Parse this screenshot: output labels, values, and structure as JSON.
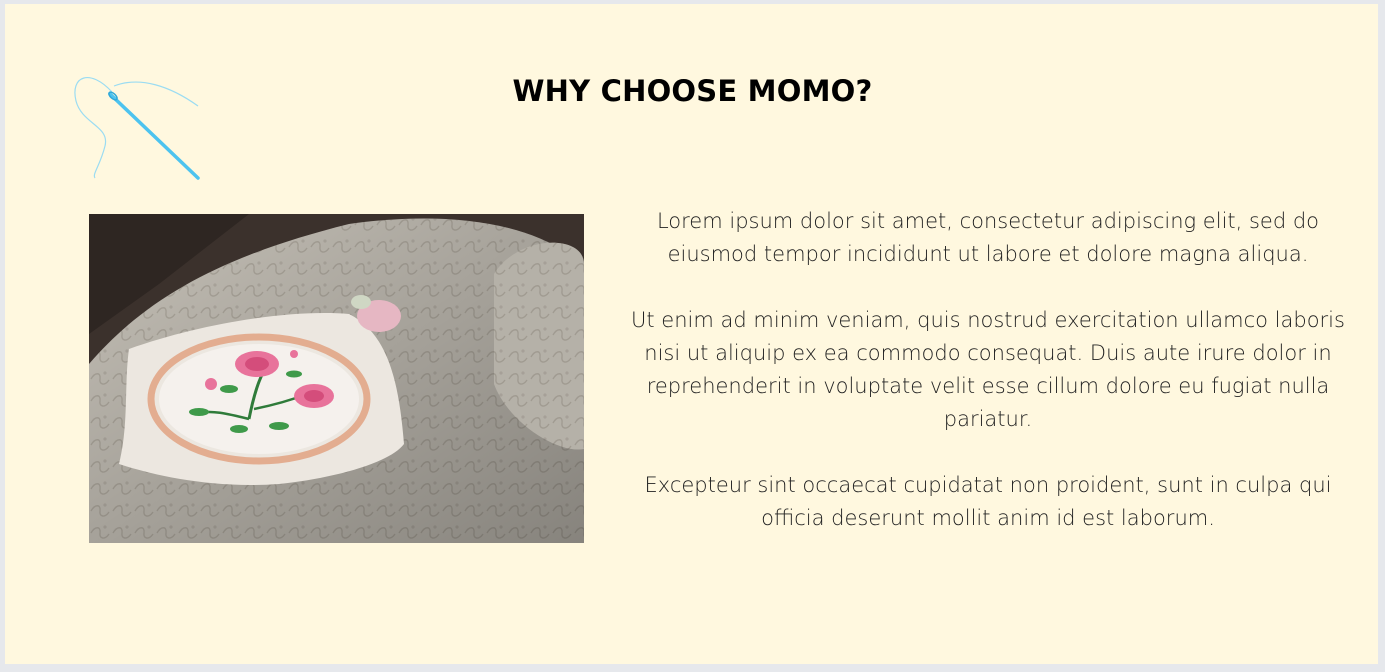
{
  "section": {
    "title": "WHY CHOOSE MOMO?",
    "paragraphs": [
      "Lorem ipsum dolor sit amet, consectetur adipiscing elit, sed do eiusmod tempor incididunt ut labore et dolore magna aliqua.",
      "Ut enim ad minim veniam, quis nostrud exercitation ullamco laboris nisi ut aliquip ex ea commodo consequat. Duis aute irure dolor in reprehenderit in voluptate velit esse cillum dolore eu fugiat nulla pariatur.",
      "Excepteur sint occaecat cupidatat non proident, sunt in culpa qui officia deserunt mollit anim id est laborum."
    ]
  },
  "colors": {
    "panel_background": "#fff8df",
    "page_background": "#e6e8ec",
    "needle_accent": "#4dc3ef"
  },
  "icons": {
    "decoration": "needle-thread-icon"
  }
}
